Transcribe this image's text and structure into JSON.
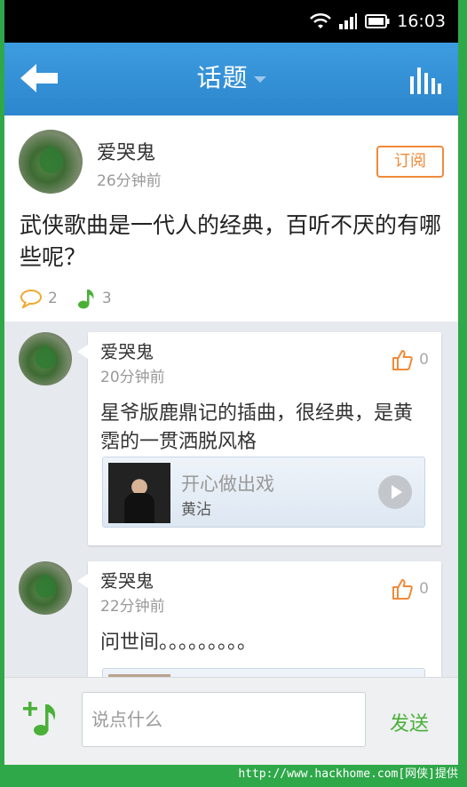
{
  "status_bar": {
    "time": "16:03"
  },
  "app_bar": {
    "title": "话题",
    "back_icon": "back-arrow-icon",
    "stats_icon": "bar-chart-icon"
  },
  "topic": {
    "user": "爱哭鬼",
    "time": "26分钟前",
    "subscribe_label": "订阅",
    "text": "武侠歌曲是一代人的经典，百听不厌的有哪些呢？",
    "comment_count": "2",
    "music_count": "3"
  },
  "comments": [
    {
      "user": "爱哭鬼",
      "time": "20分钟前",
      "likes": "0",
      "text": "星爷版鹿鼎记的插曲，很经典，是黄霑的一贯洒脱风格",
      "music": {
        "title": "开心做出戏",
        "artist": "黄沾"
      }
    },
    {
      "user": "爱哭鬼",
      "time": "22分钟前",
      "likes": "0",
      "text": "问世间。。。。。。。。。"
    }
  ],
  "input_bar": {
    "placeholder": "说点什么",
    "send_label": "发送"
  },
  "colors": {
    "app_bar": "#3d9ce0",
    "accent_orange": "#f08a3a",
    "accent_green": "#4ab038"
  },
  "watermark": "http://www.hackhome.com[网侠]提供"
}
